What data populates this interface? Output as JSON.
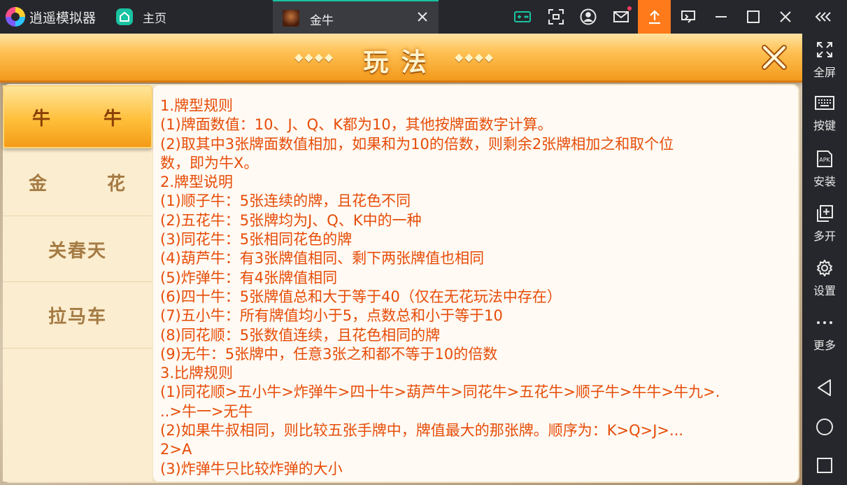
{
  "titlebar": {
    "app_name": "逍遥模拟器",
    "home_label": "主页",
    "tab_label": "金牛"
  },
  "sidebar": {
    "items": [
      {
        "label": "全屏",
        "icon": "fullscreen-icon"
      },
      {
        "label": "按键",
        "icon": "keyboard-icon"
      },
      {
        "label": "安装",
        "icon": "apk-install-icon"
      },
      {
        "label": "多开",
        "icon": "multi-instance-icon"
      },
      {
        "label": "设置",
        "icon": "gear-icon"
      },
      {
        "label": "更多",
        "icon": "more-icon"
      }
    ],
    "apk_text": "APK"
  },
  "game": {
    "title": "玩法",
    "deco_left": "◆◆◆◆",
    "deco_right": "◆◆◆◆",
    "categories": [
      {
        "a": "牛",
        "b": "牛"
      },
      {
        "a": "金",
        "b": "花"
      },
      {
        "label": "关春天"
      },
      {
        "label": "拉马车"
      }
    ],
    "rules": [
      "1.牌型规则",
      "(1)牌面数值：10、J、Q、K都为10，其他按牌面数字计算。",
      "(2)取其中3张牌面数值相加，如果和为10的倍数，则剩余2张牌相加之和取个位",
      "数，即为牛X。",
      "2.牌型说明",
      "(1)顺子牛：5张连续的牌，且花色不同",
      "(2)五花牛：5张牌均为J、Q、K中的一种",
      "(3)同花牛：5张相同花色的牌",
      "(4)葫芦牛：有3张牌值相同、剩下两张牌值也相同",
      "(5)炸弹牛：有4张牌值相同",
      "(6)四十牛：5张牌值总和大于等于40（仅在无花玩法中存在）",
      "(7)五小牛：所有牌值均小于5，点数总和小于等于10",
      "(8)同花顺：5张数值连续，且花色相同的牌",
      "(9)无牛：5张牌中，任意3张之和都不等于10的倍数",
      "3.比牌规则",
      "(1)同花顺>五小牛>炸弹牛>四十牛>葫芦牛>同花牛>五花牛>顺子牛>牛牛>牛九>.",
      "..>牛一>无牛",
      "(2)如果牛叔相同，则比较五张手牌中，牌值最大的那张牌。顺序为：K>Q>J>...",
      "2>A",
      "(3)炸弹牛只比较炸弹的大小"
    ]
  },
  "colors": {
    "accent": "#19c3a2",
    "upload": "#ff7a1a",
    "rule_text": "#e64c08",
    "header_orange": "#f39a1c"
  }
}
